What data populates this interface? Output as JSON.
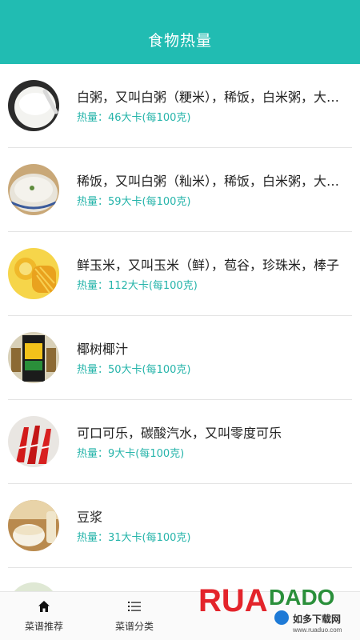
{
  "header": {
    "title": "食物热量"
  },
  "foods": [
    {
      "name": "白粥，又叫白粥（粳米），稀饭，白米粥，大米粥",
      "kcal": "热量：46大卡(每100克)",
      "icon": "white-porridge-photo"
    },
    {
      "name": "稀饭，又叫白粥（籼米），稀饭，白米粥，大米粥",
      "kcal": "热量：59大卡(每100克)",
      "icon": "rice-porridge-photo"
    },
    {
      "name": "鲜玉米，又叫玉米（鲜），苞谷，珍珠米，棒子",
      "kcal": "热量：112大卡(每100克)",
      "icon": "corn-photo"
    },
    {
      "name": "椰树椰汁",
      "kcal": "热量：50大卡(每100克)",
      "icon": "coconut-juice-photo"
    },
    {
      "name": "可口可乐，碳酸汽水，又叫零度可乐",
      "kcal": "热量：9大卡(每100克)",
      "icon": "coca-cola-photo"
    },
    {
      "name": "豆浆",
      "kcal": "热量：31大卡(每100克)",
      "icon": "soy-milk-photo"
    }
  ],
  "tabs": [
    {
      "label": "菜谱推荐",
      "icon": "home-icon"
    },
    {
      "label": "菜谱分类",
      "icon": "list-icon"
    }
  ],
  "watermark": {
    "brand": "RUANDADO",
    "sub": "如多下载网",
    "url": "www.ruaduo.com"
  }
}
